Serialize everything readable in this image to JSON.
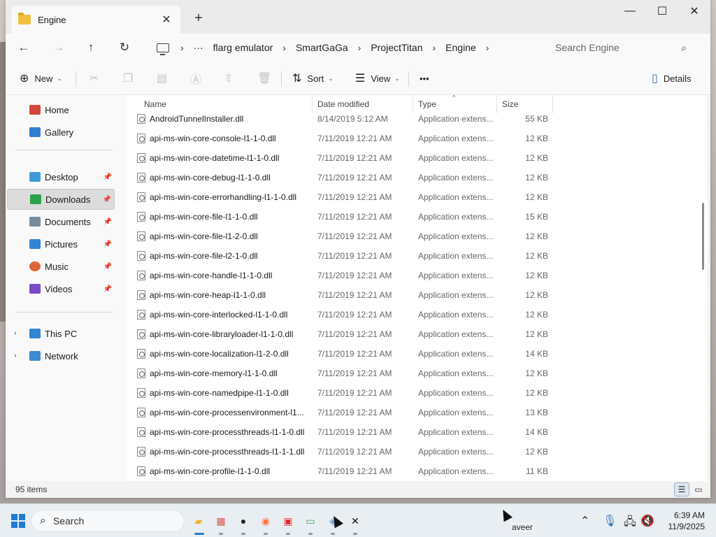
{
  "window": {
    "tab_title": "Engine",
    "new_tab_glyph": "+",
    "close_tab_glyph": "✕",
    "minimize_glyph": "—",
    "maximize_glyph": "☐",
    "close_glyph": "✕"
  },
  "nav": {
    "back": "←",
    "forward": "→",
    "up": "↑",
    "refresh": "↻",
    "more": "···",
    "breadcrumbs": [
      "flarg emulator",
      "SmartGaGa",
      "ProjectTitan",
      "Engine"
    ],
    "search_placeholder": "Search Engine"
  },
  "commands": {
    "new_label": "New",
    "sort_label": "Sort",
    "view_label": "View",
    "more_label": "•••",
    "details_label": "Details"
  },
  "sidebar": {
    "items": [
      {
        "label": "Home",
        "icon": "home-icon",
        "color": "#d4463a"
      },
      {
        "label": "Gallery",
        "icon": "gallery-icon",
        "color": "#2f7fd1"
      },
      {
        "label": "Desktop",
        "icon": "desktop-icon",
        "color": "#3d9bd8"
      },
      {
        "label": "Downloads",
        "icon": "downloads-icon",
        "color": "#2aa34a"
      },
      {
        "label": "Documents",
        "icon": "documents-icon",
        "color": "#7a8b9c"
      },
      {
        "label": "Pictures",
        "icon": "pictures-icon",
        "color": "#2f86d6"
      },
      {
        "label": "Music",
        "icon": "music-icon",
        "color": "#e0643a"
      },
      {
        "label": "Videos",
        "icon": "videos-icon",
        "color": "#7b4bc8"
      },
      {
        "label": "This PC",
        "icon": "this-pc-icon",
        "color": "#2f86d6"
      },
      {
        "label": "Network",
        "icon": "network-icon",
        "color": "#3d8bd0"
      }
    ]
  },
  "columns": {
    "name": "Name",
    "date": "Date modified",
    "type": "Type",
    "size": "Size"
  },
  "files": [
    {
      "name": "AndroidTunnelInstaller.dll",
      "date": "8/14/2019 5:12 AM",
      "type": "Application extens...",
      "size": "55 KB"
    },
    {
      "name": "api-ms-win-core-console-l1-1-0.dll",
      "date": "7/11/2019 12:21 AM",
      "type": "Application extens...",
      "size": "12 KB"
    },
    {
      "name": "api-ms-win-core-datetime-l1-1-0.dll",
      "date": "7/11/2019 12:21 AM",
      "type": "Application extens...",
      "size": "12 KB"
    },
    {
      "name": "api-ms-win-core-debug-l1-1-0.dll",
      "date": "7/11/2019 12:21 AM",
      "type": "Application extens...",
      "size": "12 KB"
    },
    {
      "name": "api-ms-win-core-errorhandling-l1-1-0.dll",
      "date": "7/11/2019 12:21 AM",
      "type": "Application extens...",
      "size": "12 KB"
    },
    {
      "name": "api-ms-win-core-file-l1-1-0.dll",
      "date": "7/11/2019 12:21 AM",
      "type": "Application extens...",
      "size": "15 KB"
    },
    {
      "name": "api-ms-win-core-file-l1-2-0.dll",
      "date": "7/11/2019 12:21 AM",
      "type": "Application extens...",
      "size": "12 KB"
    },
    {
      "name": "api-ms-win-core-file-l2-1-0.dll",
      "date": "7/11/2019 12:21 AM",
      "type": "Application extens...",
      "size": "12 KB"
    },
    {
      "name": "api-ms-win-core-handle-l1-1-0.dll",
      "date": "7/11/2019 12:21 AM",
      "type": "Application extens...",
      "size": "12 KB"
    },
    {
      "name": "api-ms-win-core-heap-l1-1-0.dll",
      "date": "7/11/2019 12:21 AM",
      "type": "Application extens...",
      "size": "12 KB"
    },
    {
      "name": "api-ms-win-core-interlocked-l1-1-0.dll",
      "date": "7/11/2019 12:21 AM",
      "type": "Application extens...",
      "size": "12 KB"
    },
    {
      "name": "api-ms-win-core-libraryloader-l1-1-0.dll",
      "date": "7/11/2019 12:21 AM",
      "type": "Application extens...",
      "size": "12 KB"
    },
    {
      "name": "api-ms-win-core-localization-l1-2-0.dll",
      "date": "7/11/2019 12:21 AM",
      "type": "Application extens...",
      "size": "14 KB"
    },
    {
      "name": "api-ms-win-core-memory-l1-1-0.dll",
      "date": "7/11/2019 12:21 AM",
      "type": "Application extens...",
      "size": "12 KB"
    },
    {
      "name": "api-ms-win-core-namedpipe-l1-1-0.dll",
      "date": "7/11/2019 12:21 AM",
      "type": "Application extens...",
      "size": "12 KB"
    },
    {
      "name": "api-ms-win-core-processenvironment-l1...",
      "date": "7/11/2019 12:21 AM",
      "type": "Application extens...",
      "size": "13 KB"
    },
    {
      "name": "api-ms-win-core-processthreads-l1-1-0.dll",
      "date": "7/11/2019 12:21 AM",
      "type": "Application extens...",
      "size": "14 KB"
    },
    {
      "name": "api-ms-win-core-processthreads-l1-1-1.dll",
      "date": "7/11/2019 12:21 AM",
      "type": "Application extens...",
      "size": "12 KB"
    },
    {
      "name": "api-ms-win-core-profile-l1-1-0.dll",
      "date": "7/11/2019 12:21 AM",
      "type": "Application extens...",
      "size": "11 KB"
    }
  ],
  "status": {
    "item_count": "95 items"
  },
  "taskbar": {
    "search_label": "Search",
    "tooltip_fragment": "aveer",
    "time": "6:39 AM",
    "date": "11/9/2025",
    "apps": [
      {
        "icon": "file-explorer-icon",
        "color": "#f0b429",
        "active": true
      },
      {
        "icon": "app-grid-icon",
        "color": "#d9534f",
        "active": false
      },
      {
        "icon": "game-app-icon",
        "color": "#222222",
        "active": false
      },
      {
        "icon": "firefox-icon",
        "color": "#ff7139",
        "active": false
      },
      {
        "icon": "remote-app-icon",
        "color": "#e02f2f",
        "active": false
      },
      {
        "icon": "terminal-app-icon",
        "color": "#3aa656",
        "active": false
      },
      {
        "icon": "emulator-app-icon",
        "color": "#6aa8d8",
        "active": false
      },
      {
        "icon": "capcut-icon",
        "color": "#111111",
        "active": false
      }
    ]
  }
}
